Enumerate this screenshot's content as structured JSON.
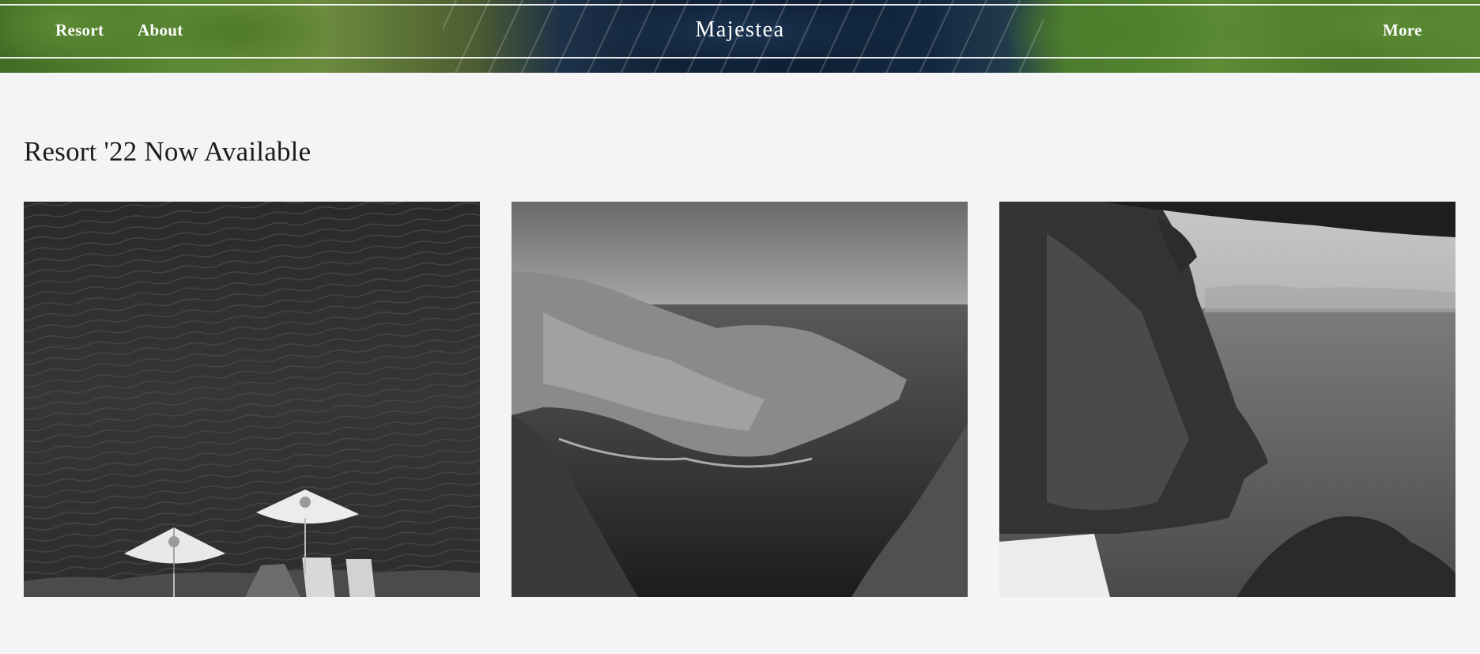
{
  "header": {
    "nav_left": [
      {
        "label": "Resort"
      },
      {
        "label": "About"
      }
    ],
    "brand": "Majestea",
    "nav_right": [
      {
        "label": "More"
      }
    ]
  },
  "section": {
    "title": "Resort '22 Now Available"
  },
  "colors": {
    "page_background": "#f4f4f4",
    "header_text": "#ffffff",
    "title_text": "#1c1c1c"
  }
}
